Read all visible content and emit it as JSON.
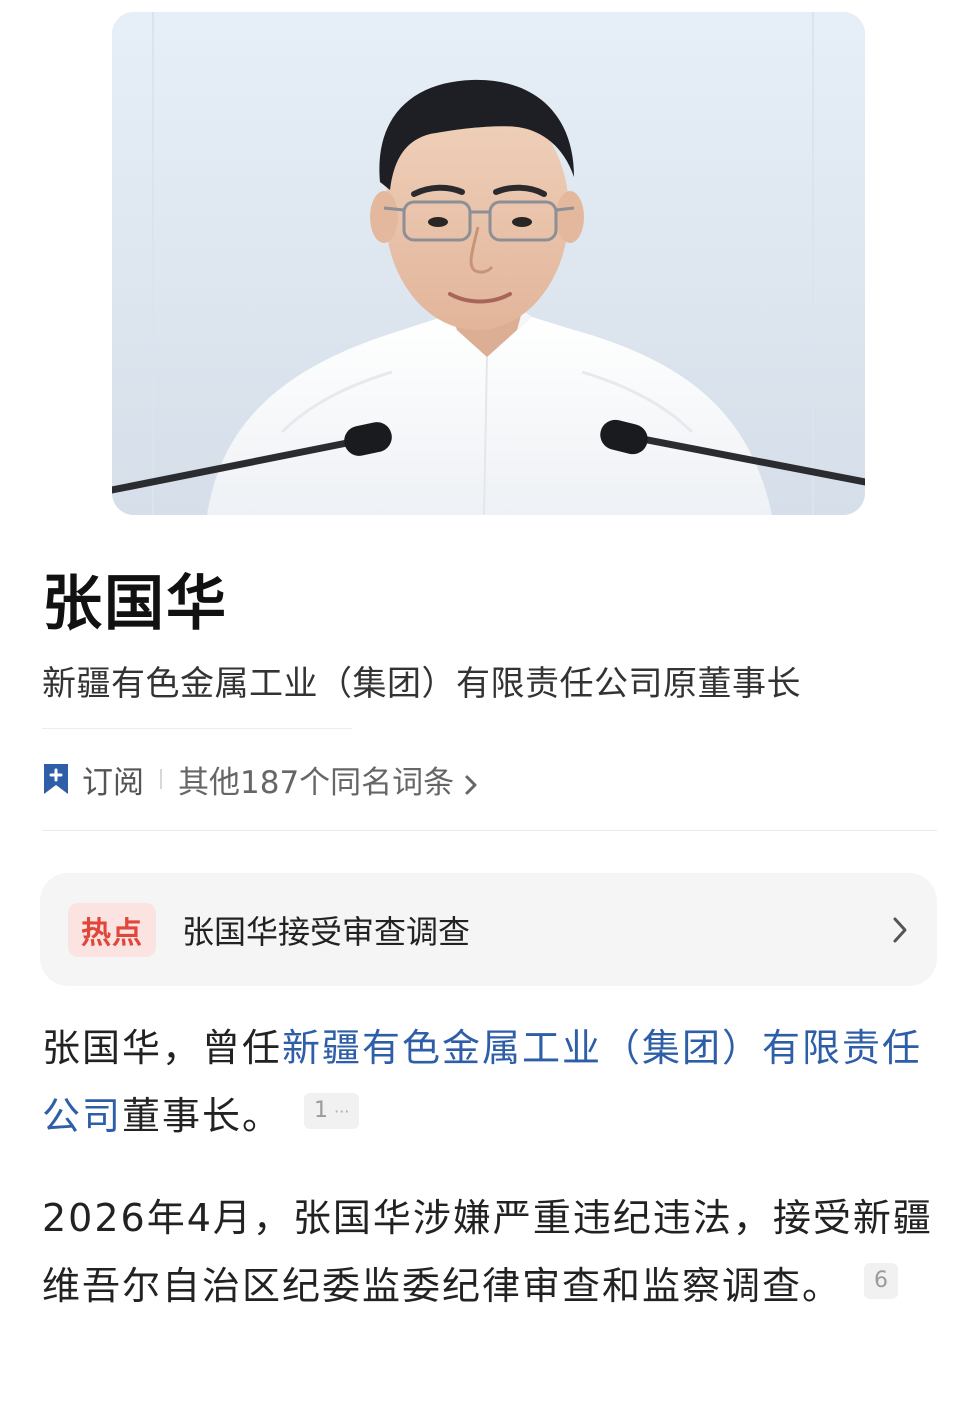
{
  "entry": {
    "title": "张国华",
    "subtitle": "新疆有色金属工业（集团）有限责任公司原董事长"
  },
  "actions": {
    "subscribe_icon": "bookmark-plus-icon",
    "subscribe_label": "订阅",
    "other_entries_label": "其他187个同名词条",
    "other_entries_icon": "chevron-right-icon"
  },
  "hot": {
    "badge": "热点",
    "text": "张国华接受审查调查",
    "icon": "chevron-right-icon"
  },
  "paragraphs": {
    "p1": {
      "prefix": "张国华，曾任",
      "link": "新疆有色金属工业（集团）有限责任公司",
      "suffix": "董事长。",
      "ref": "1",
      "ref_more": "···"
    },
    "p2": {
      "text": "2026年4月，张国华涉嫌严重违纪违法，接受新疆维吾尔自治区纪委监委纪律审查和监察调查。",
      "ref": "6"
    }
  },
  "colors": {
    "link": "#2f5ea8",
    "hot_badge_text": "#e0463a",
    "hot_badge_bg": "#fbe3e1",
    "bookmark_icon": "#2f5ea8"
  }
}
